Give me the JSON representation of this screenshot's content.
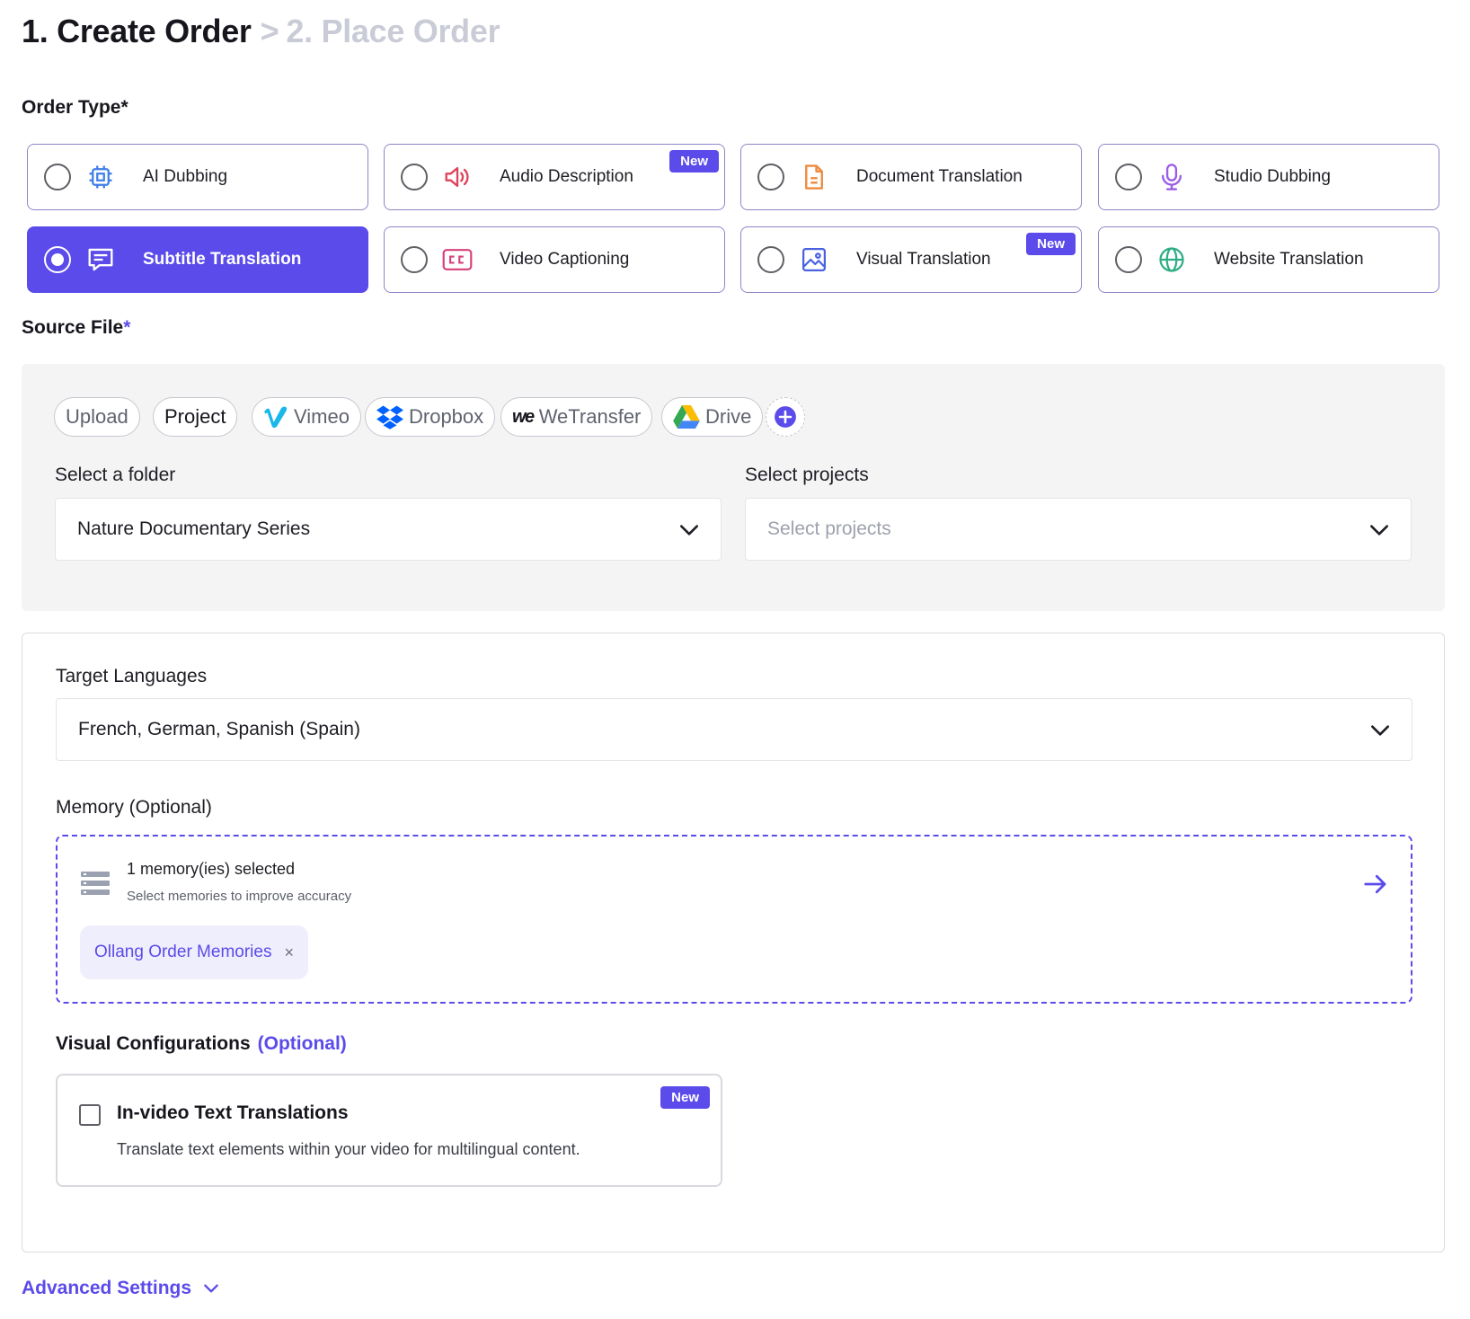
{
  "header": {
    "step_active": "1. Create Order",
    "separator": ">",
    "step_next": "2. Place Order"
  },
  "order_type": {
    "label": "Order Type",
    "required_mark": "*",
    "badge_new": "New",
    "options": [
      {
        "label": "AI Dubbing",
        "icon": "chip-icon",
        "selected": false,
        "is_new": false
      },
      {
        "label": "Audio Description",
        "icon": "speaker-icon",
        "selected": false,
        "is_new": true
      },
      {
        "label": "Document Translation",
        "icon": "document-icon",
        "selected": false,
        "is_new": false
      },
      {
        "label": "Studio Dubbing",
        "icon": "microphone-icon",
        "selected": false,
        "is_new": false
      },
      {
        "label": "Subtitle Translation",
        "icon": "subtitle-icon",
        "selected": true,
        "is_new": false
      },
      {
        "label": "Video Captioning",
        "icon": "cc-icon",
        "selected": false,
        "is_new": false
      },
      {
        "label": "Visual Translation",
        "icon": "image-icon",
        "selected": false,
        "is_new": true
      },
      {
        "label": "Website Translation",
        "icon": "globe-icon",
        "selected": false,
        "is_new": false
      }
    ]
  },
  "source_file": {
    "label": "Source File",
    "required_mark": "*",
    "tabs": [
      {
        "label": "Upload",
        "icon": "",
        "active": false
      },
      {
        "label": "Project",
        "icon": "",
        "active": true
      },
      {
        "label": "Vimeo",
        "icon": "vimeo-icon",
        "active": false
      },
      {
        "label": "Dropbox",
        "icon": "dropbox-icon",
        "active": false
      },
      {
        "label": "WeTransfer",
        "icon": "wetransfer-icon",
        "active": false
      },
      {
        "label": "Drive",
        "icon": "drive-icon",
        "active": false
      }
    ],
    "folder_label": "Select a folder",
    "folder_value": "Nature Documentary Series",
    "projects_label": "Select projects",
    "projects_placeholder": "Select projects"
  },
  "target_languages": {
    "label": "Target Languages",
    "value": "French, German, Spanish (Spain)"
  },
  "memory": {
    "label": "Memory (Optional)",
    "title": "1 memory(ies) selected",
    "subtitle": "Select memories to improve accuracy",
    "tag": "Ollang Order Memories",
    "tag_remove": "×"
  },
  "visual_config": {
    "label": "Visual Configurations",
    "optional": "(Optional)",
    "card_title": "In-video Text Translations",
    "card_desc": "Translate text elements within your video for multilingual content.",
    "badge": "New",
    "checked": false
  },
  "advanced": {
    "label": "Advanced Settings"
  },
  "colors": {
    "accent": "#5b4bea",
    "accent_light": "#efeefc",
    "border_card": "#8a86c9",
    "panel_bg": "#f4f4f5"
  }
}
